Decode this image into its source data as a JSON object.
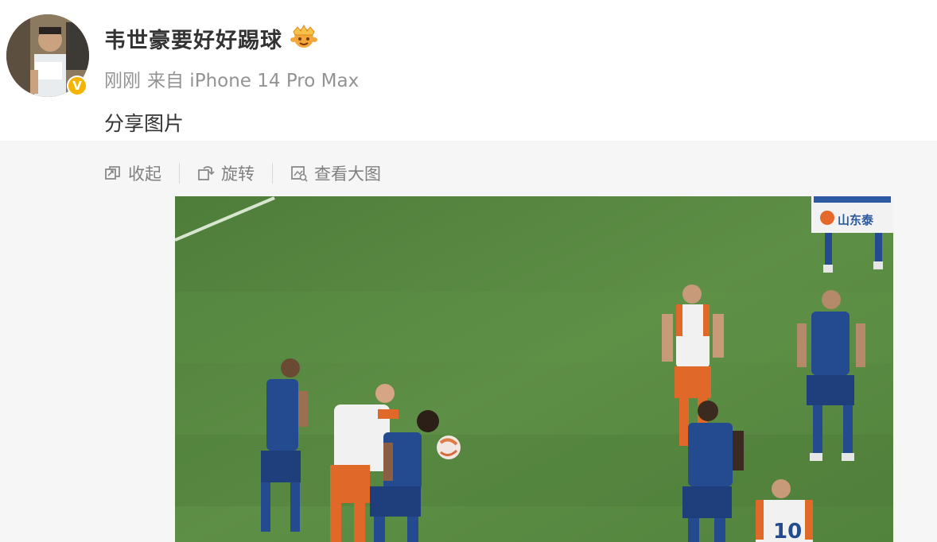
{
  "author": {
    "name": "韦世豪要好好踢球",
    "verified_mark": "V"
  },
  "meta": {
    "time": "刚刚",
    "source": "来自 iPhone 14 Pro Max"
  },
  "post": {
    "text": "分享图片"
  },
  "toolbar": {
    "collapse": "收起",
    "rotate": "旋转",
    "view_large": "查看大图"
  },
  "image": {
    "board_text": "山东泰",
    "jersey_number": "10"
  },
  "colors": {
    "pitch": "#5b8b43",
    "blue_kit": "#244a8f",
    "orange_kit": "#e0692a",
    "meta_text": "#939393"
  }
}
